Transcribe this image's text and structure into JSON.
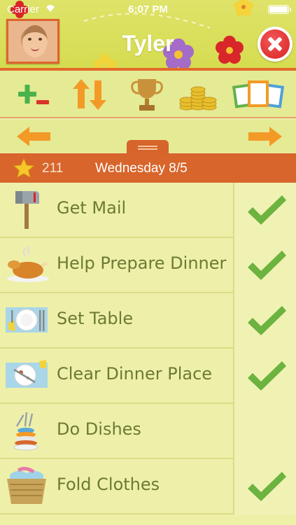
{
  "status": {
    "carrier": "Carrier",
    "time": "6:07 PM"
  },
  "header": {
    "name": "Tyler"
  },
  "toolbar": {
    "icons": [
      "plus-minus-icon",
      "sort-arrows-icon",
      "trophy-icon",
      "coins-icon",
      "frames-icon"
    ]
  },
  "summary": {
    "points": "211",
    "date": "Wednesday 8/5"
  },
  "chores": [
    {
      "label": "Get Mail",
      "icon": "mailbox-icon",
      "done": true
    },
    {
      "label": "Help Prepare Dinner",
      "icon": "turkey-icon",
      "done": true
    },
    {
      "label": "Set Table",
      "icon": "place-setting-icon",
      "done": true
    },
    {
      "label": "Clear Dinner Place",
      "icon": "dirty-plate-icon",
      "done": true
    },
    {
      "label": "Do Dishes",
      "icon": "dish-stack-icon",
      "done": false
    },
    {
      "label": "Fold Clothes",
      "icon": "laundry-basket-icon",
      "done": true
    }
  ],
  "colors": {
    "accent": "#d8652b",
    "check": "#6cb33f",
    "label": "#6c7a35"
  }
}
